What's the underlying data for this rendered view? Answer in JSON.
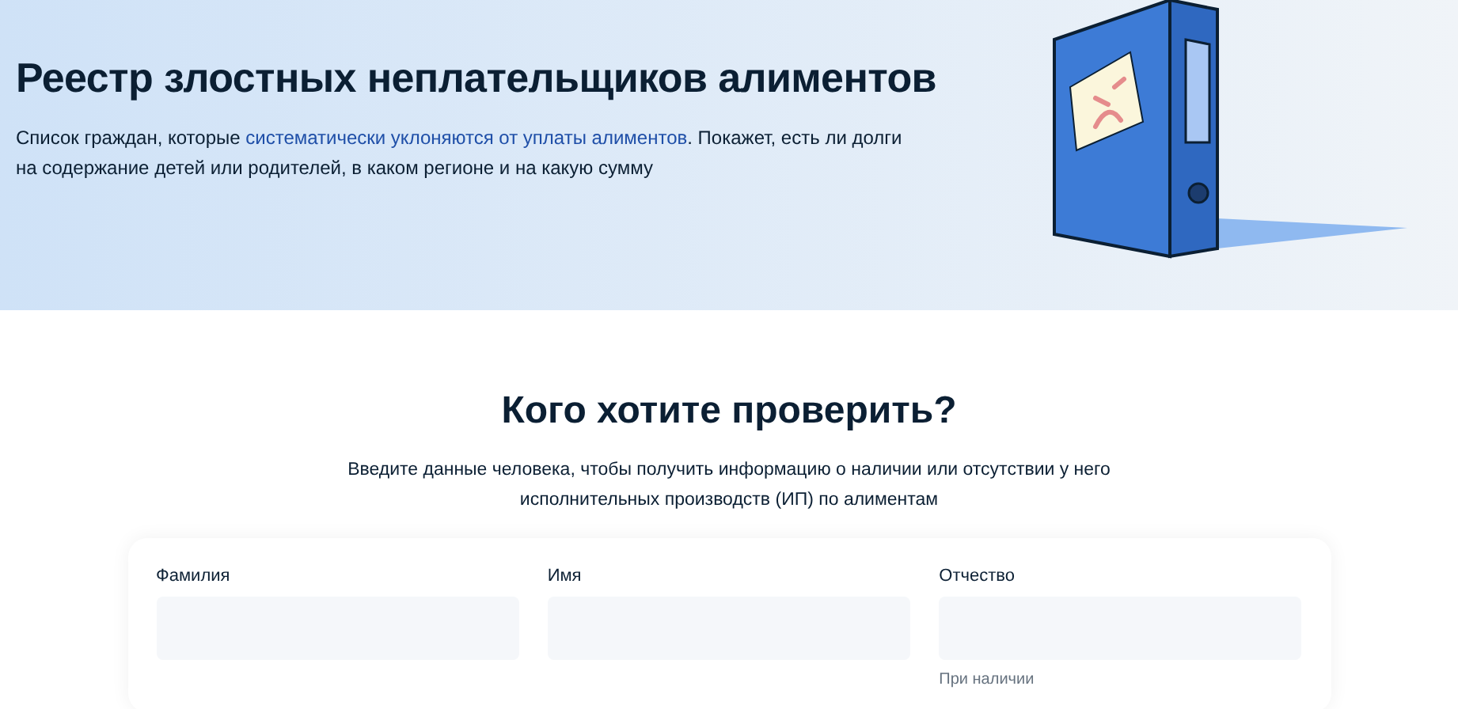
{
  "hero": {
    "title": "Реестр злостных неплательщиков алиментов",
    "description": "Список граждан, которые ",
    "link": "систематически уклоняются от уплаты алиментов",
    "description_end": ". Покажет, есть ли долги на содержание детей или родителей, в каком регионе и на какую сумму"
  },
  "search": {
    "title": "Кого хотите проверить?",
    "subtitle": "Введите данные человека, чтобы получить информацию о наличии или отсутствии у него исполнительных производств (ИП) по алиментам",
    "fields": [
      {
        "label": "Фамилия"
      },
      {
        "label": "Имя"
      },
      {
        "label": "Отчество",
        "hint": "При наличии"
      }
    ]
  }
}
